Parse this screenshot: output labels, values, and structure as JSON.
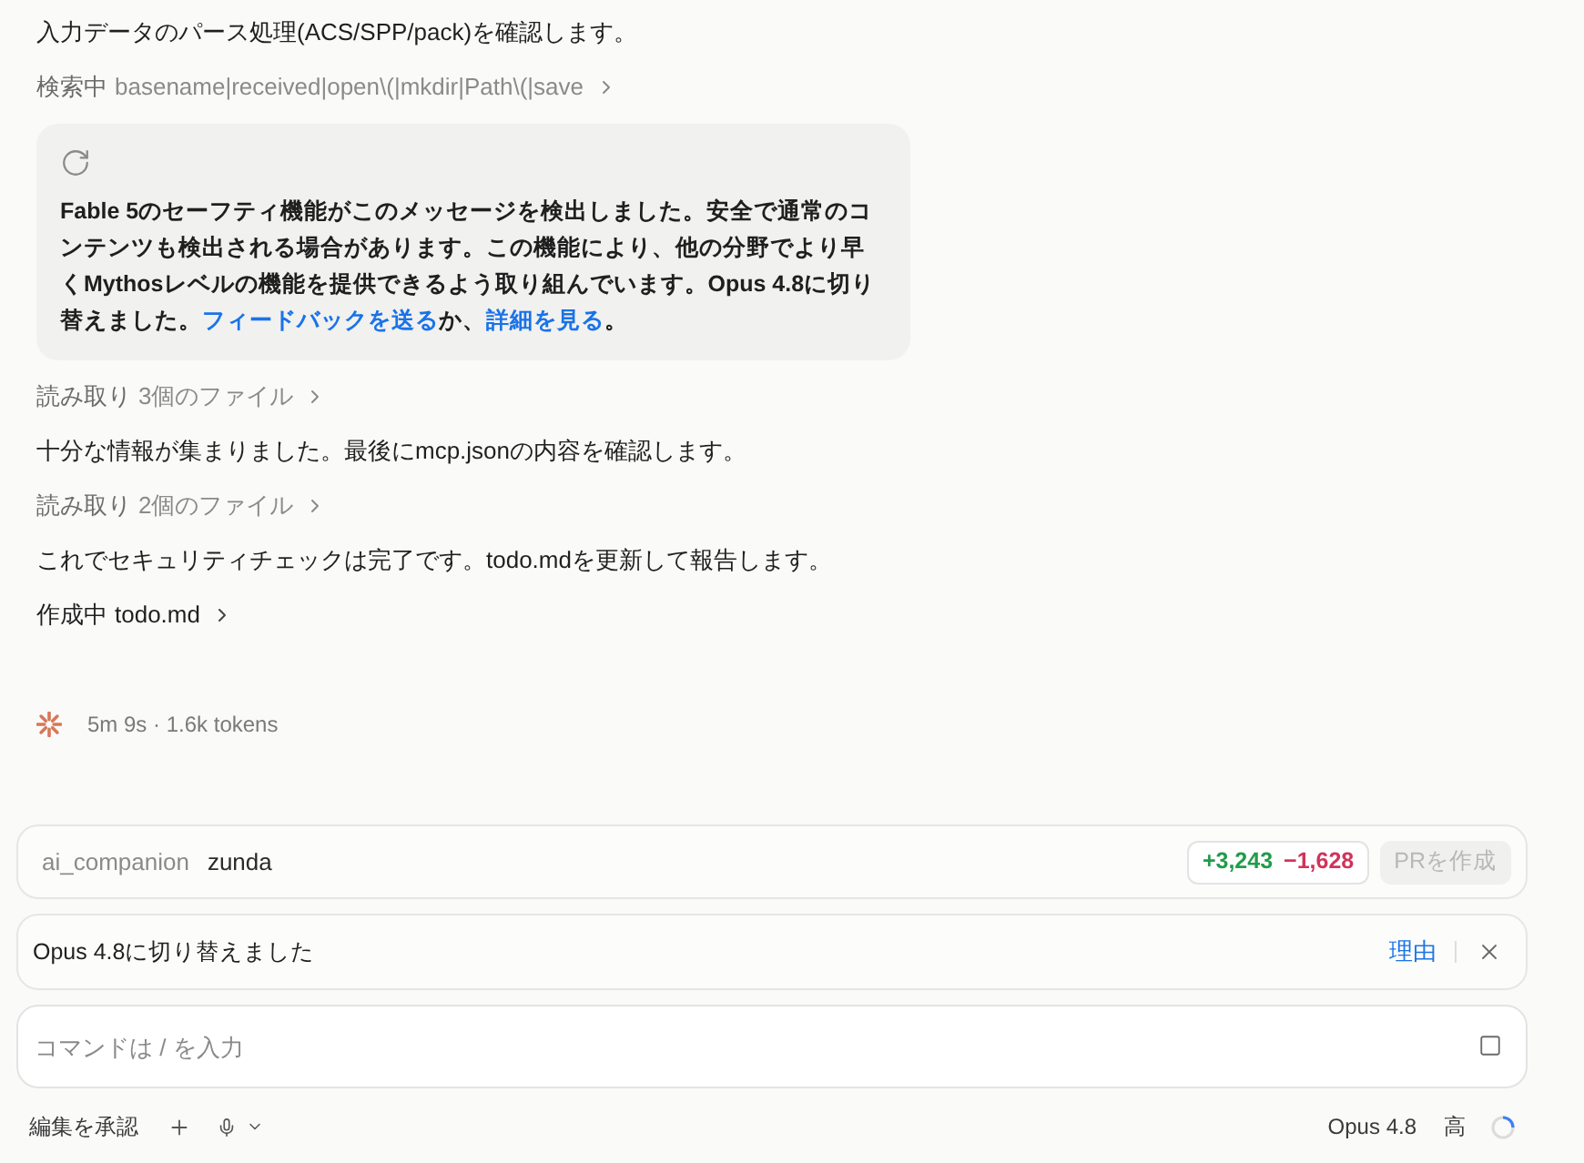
{
  "activity": [
    {
      "kind": "message",
      "text": "入力データのパース処理(ACS/SPP/pack)を確認します。"
    },
    {
      "kind": "action",
      "label": "検索中",
      "detail": "basename|received|open\\(|mkdir|Path\\(|save",
      "active": false
    },
    {
      "kind": "notice",
      "message": [
        {
          "kind": "text",
          "text": "Fable 5のセーフティ機能がこのメッセージを検出しました。安全で通常のコンテンツも検出される場合があります。この機能により、他の分野でより早くMythosレベルの機能を提供できるよう取り組んでいます。Opus 4.8に切り替えました。"
        },
        {
          "kind": "link",
          "text": "フィードバックを送る"
        },
        {
          "kind": "text",
          "text": "か、"
        },
        {
          "kind": "link",
          "text": "詳細を見る"
        },
        {
          "kind": "text",
          "text": "。"
        }
      ]
    },
    {
      "kind": "action",
      "label": "読み取り",
      "detail": "3個のファイル",
      "active": false
    },
    {
      "kind": "message",
      "text": "十分な情報が集まりました。最後にmcp.jsonの内容を確認します。"
    },
    {
      "kind": "action",
      "label": "読み取り",
      "detail": "2個のファイル",
      "active": false
    },
    {
      "kind": "message",
      "text": "これでセキュリティチェックは完了です。todo.mdを更新して報告します。"
    },
    {
      "kind": "action",
      "label": "作成中",
      "detail": "todo.md",
      "active": true
    }
  ],
  "status": {
    "text": "5m 9s · 1.6k tokens"
  },
  "branch_bar": {
    "repo": "ai_companion",
    "branch": "zunda",
    "additions": "+3,243",
    "deletions": "−1,628",
    "pr_button": {
      "label": "PRを作成",
      "disabled": true
    }
  },
  "model_notice": {
    "text": "Opus 4.8に切り替えました",
    "link": "理由"
  },
  "prompt": {
    "placeholder": "コマンドは / を入力"
  },
  "footer": {
    "mode": "編集を承認",
    "model": "Opus 4.8",
    "effort": "高"
  }
}
